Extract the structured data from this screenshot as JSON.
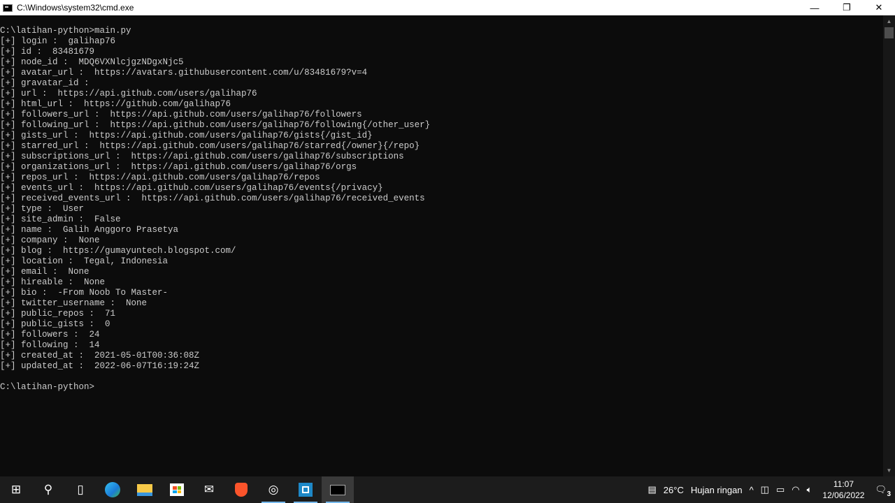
{
  "window": {
    "title": "C:\\Windows\\system32\\cmd.exe",
    "minimize": "—",
    "maximize": "❐",
    "close": "✕"
  },
  "console": {
    "lines": [
      "C:\\latihan-python>main.py",
      "[+] login :  galihap76",
      "[+] id :  83481679",
      "[+] node_id :  MDQ6VXNlcjgzNDgxNjc5",
      "[+] avatar_url :  https://avatars.githubusercontent.com/u/83481679?v=4",
      "[+] gravatar_id :",
      "[+] url :  https://api.github.com/users/galihap76",
      "[+] html_url :  https://github.com/galihap76",
      "[+] followers_url :  https://api.github.com/users/galihap76/followers",
      "[+] following_url :  https://api.github.com/users/galihap76/following{/other_user}",
      "[+] gists_url :  https://api.github.com/users/galihap76/gists{/gist_id}",
      "[+] starred_url :  https://api.github.com/users/galihap76/starred{/owner}{/repo}",
      "[+] subscriptions_url :  https://api.github.com/users/galihap76/subscriptions",
      "[+] organizations_url :  https://api.github.com/users/galihap76/orgs",
      "[+] repos_url :  https://api.github.com/users/galihap76/repos",
      "[+] events_url :  https://api.github.com/users/galihap76/events{/privacy}",
      "[+] received_events_url :  https://api.github.com/users/galihap76/received_events",
      "[+] type :  User",
      "[+] site_admin :  False",
      "[+] name :  Galih Anggoro Prasetya",
      "[+] company :  None",
      "[+] blog :  https://gumayuntech.blogspot.com/",
      "[+] location :  Tegal, Indonesia",
      "[+] email :  None",
      "[+] hireable :  None",
      "[+] bio :  -From Noob To Master-",
      "[+] twitter_username :  None",
      "[+] public_repos :  71",
      "[+] public_gists :  0",
      "[+] followers :  24",
      "[+] following :  14",
      "[+] created_at :  2021-05-01T00:36:08Z",
      "[+] updated_at :  2022-06-07T16:19:24Z",
      "",
      "C:\\latihan-python>"
    ]
  },
  "taskbar": {
    "weather_temp": "26°C",
    "weather_desc": "Hujan ringan",
    "time": "11:07",
    "date": "12/06/2022",
    "notifications": "3"
  }
}
